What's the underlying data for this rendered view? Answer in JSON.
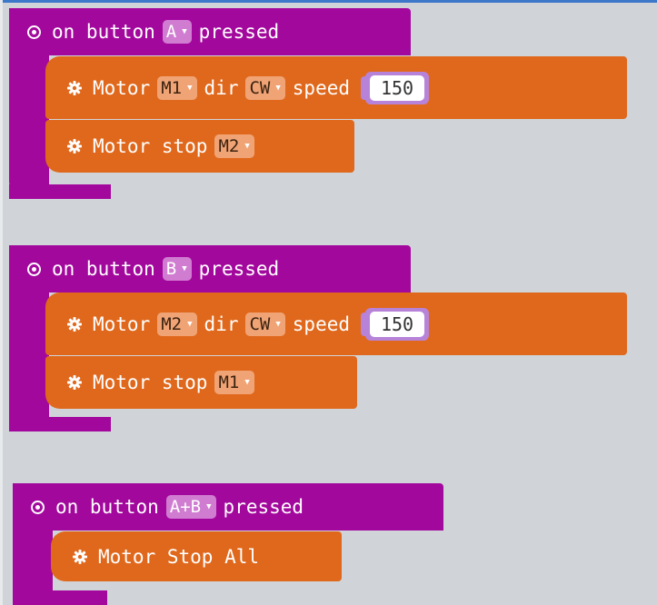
{
  "colors": {
    "event_block": "#a3089d",
    "motor_block": "#e0681c",
    "orange_dropdown": "#f0a476",
    "purple_dropdown": "#d07dd1",
    "number_slot": "#b783d9",
    "workspace": "#f5f6f7"
  },
  "icons": {
    "event": "radio-icon",
    "motor": "gear-icon"
  },
  "events": [
    {
      "on": "on button",
      "button": "A",
      "pressed": "pressed",
      "statements": [
        {
          "motor": "Motor",
          "motor_id": "M1",
          "dir": "dir",
          "direction": "CW",
          "speed": "speed",
          "speed_value": "150"
        },
        {
          "stop": "Motor stop",
          "motor_id": "M2"
        }
      ]
    },
    {
      "on": "on button",
      "button": "B",
      "pressed": "pressed",
      "statements": [
        {
          "motor": "Motor",
          "motor_id": "M2",
          "dir": "dir",
          "direction": "CW",
          "speed": "speed",
          "speed_value": "150"
        },
        {
          "stop": "Motor stop",
          "motor_id": "M1"
        }
      ]
    },
    {
      "on": "on button",
      "button": "A+B",
      "pressed": "pressed",
      "statements": [
        {
          "stop_all": "Motor Stop All"
        }
      ]
    }
  ]
}
